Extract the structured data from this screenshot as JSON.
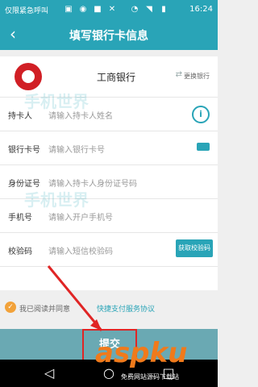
{
  "status": {
    "text": "仅限紧急呼叫",
    "time": "16:24"
  },
  "header": {
    "title": "填写银行卡信息"
  },
  "bank": {
    "name": "工商银行",
    "change_label": "更换银行"
  },
  "form": {
    "rows": [
      {
        "label": "持卡人",
        "placeholder": "请输入持卡人姓名"
      },
      {
        "label": "银行卡号",
        "placeholder": "请输入银行卡号"
      },
      {
        "label": "身份证号",
        "placeholder": "请输入持卡人身份证号码"
      },
      {
        "label": "手机号",
        "placeholder": "请输入开户手机号"
      },
      {
        "label": "校验码",
        "placeholder": "请输入短信校验码"
      }
    ],
    "code_button": "获取校验码"
  },
  "agreement": {
    "text": "我已阅读并同意",
    "link": "快捷支付服务协议"
  },
  "submit": {
    "label": "提交"
  },
  "overlay": {
    "watermark": "手机世界",
    "brand": "aspku",
    "brand_sub": "免费网站源码下载站"
  },
  "colors": {
    "accent": "#29a4b7",
    "highlight": "#e02525"
  }
}
